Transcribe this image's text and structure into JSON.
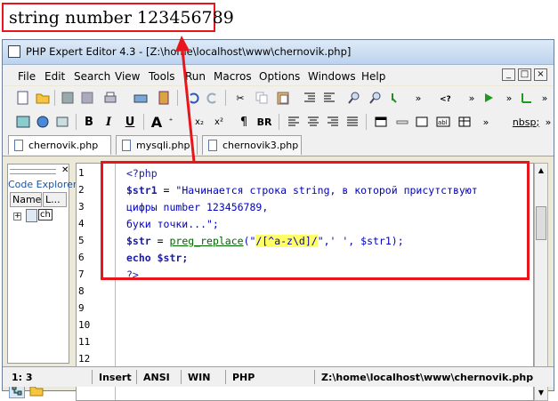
{
  "output": {
    "text": "string number 123456789"
  },
  "window": {
    "title": "PHP Expert Editor 4.3 - [Z:\\home\\localhost\\www\\chernovik.php]"
  },
  "menu": {
    "items": [
      "File",
      "Edit",
      "Search",
      "View",
      "Tools",
      "Run",
      "Macros",
      "Options",
      "Windows",
      "Help"
    ]
  },
  "toolbar2": {
    "bold": "B",
    "italic": "I",
    "underline": "U",
    "big_a": "A",
    "subscript": "x₂",
    "superscript": "x²",
    "paragraph": "¶",
    "br": "BR",
    "nbsp": "nbsp;"
  },
  "tabs": [
    {
      "label": "chernovik.php"
    },
    {
      "label": "mysqli.php"
    },
    {
      "label": "chernovik3.php"
    }
  ],
  "explorer": {
    "title": "Code Explorer",
    "col_name": "Name",
    "col_l": "L...",
    "item": "ch"
  },
  "editor": {
    "line_numbers": [
      "1",
      "2",
      "3",
      "4",
      "5",
      "6",
      "7",
      "8",
      "9",
      "10",
      "11",
      "12"
    ],
    "code": {
      "l1": "<?php",
      "l2_var": "$str1",
      "l2_eq": " = ",
      "l2_str": "\"Начинается строка string, в которой присутствуют",
      "l3": "цифры number 123456789,",
      "l4": "буки точки...\";",
      "l5_var": "$str",
      "l5_eq": " = ",
      "l5_fn": "preg_replace",
      "l5_open": "(\"",
      "l5_regex": "/[^a-z\\d]/",
      "l5_rest": "\",' ', $str1);",
      "l6_kw": "echo",
      "l6_var": " $str;",
      "l7": "?>"
    }
  },
  "status": {
    "pos": "1: 3",
    "mode": "Insert",
    "enc": "ANSI",
    "eol": "WIN",
    "lang": "PHP",
    "path": "Z:\\home\\localhost\\www\\chernovik.php"
  },
  "colors": {
    "accent_red": "#e8161c",
    "code_blue": "#1a1aa6",
    "string_blue": "#0000c0",
    "regex_highlight": "#ffff66",
    "fn_green": "#006400"
  }
}
